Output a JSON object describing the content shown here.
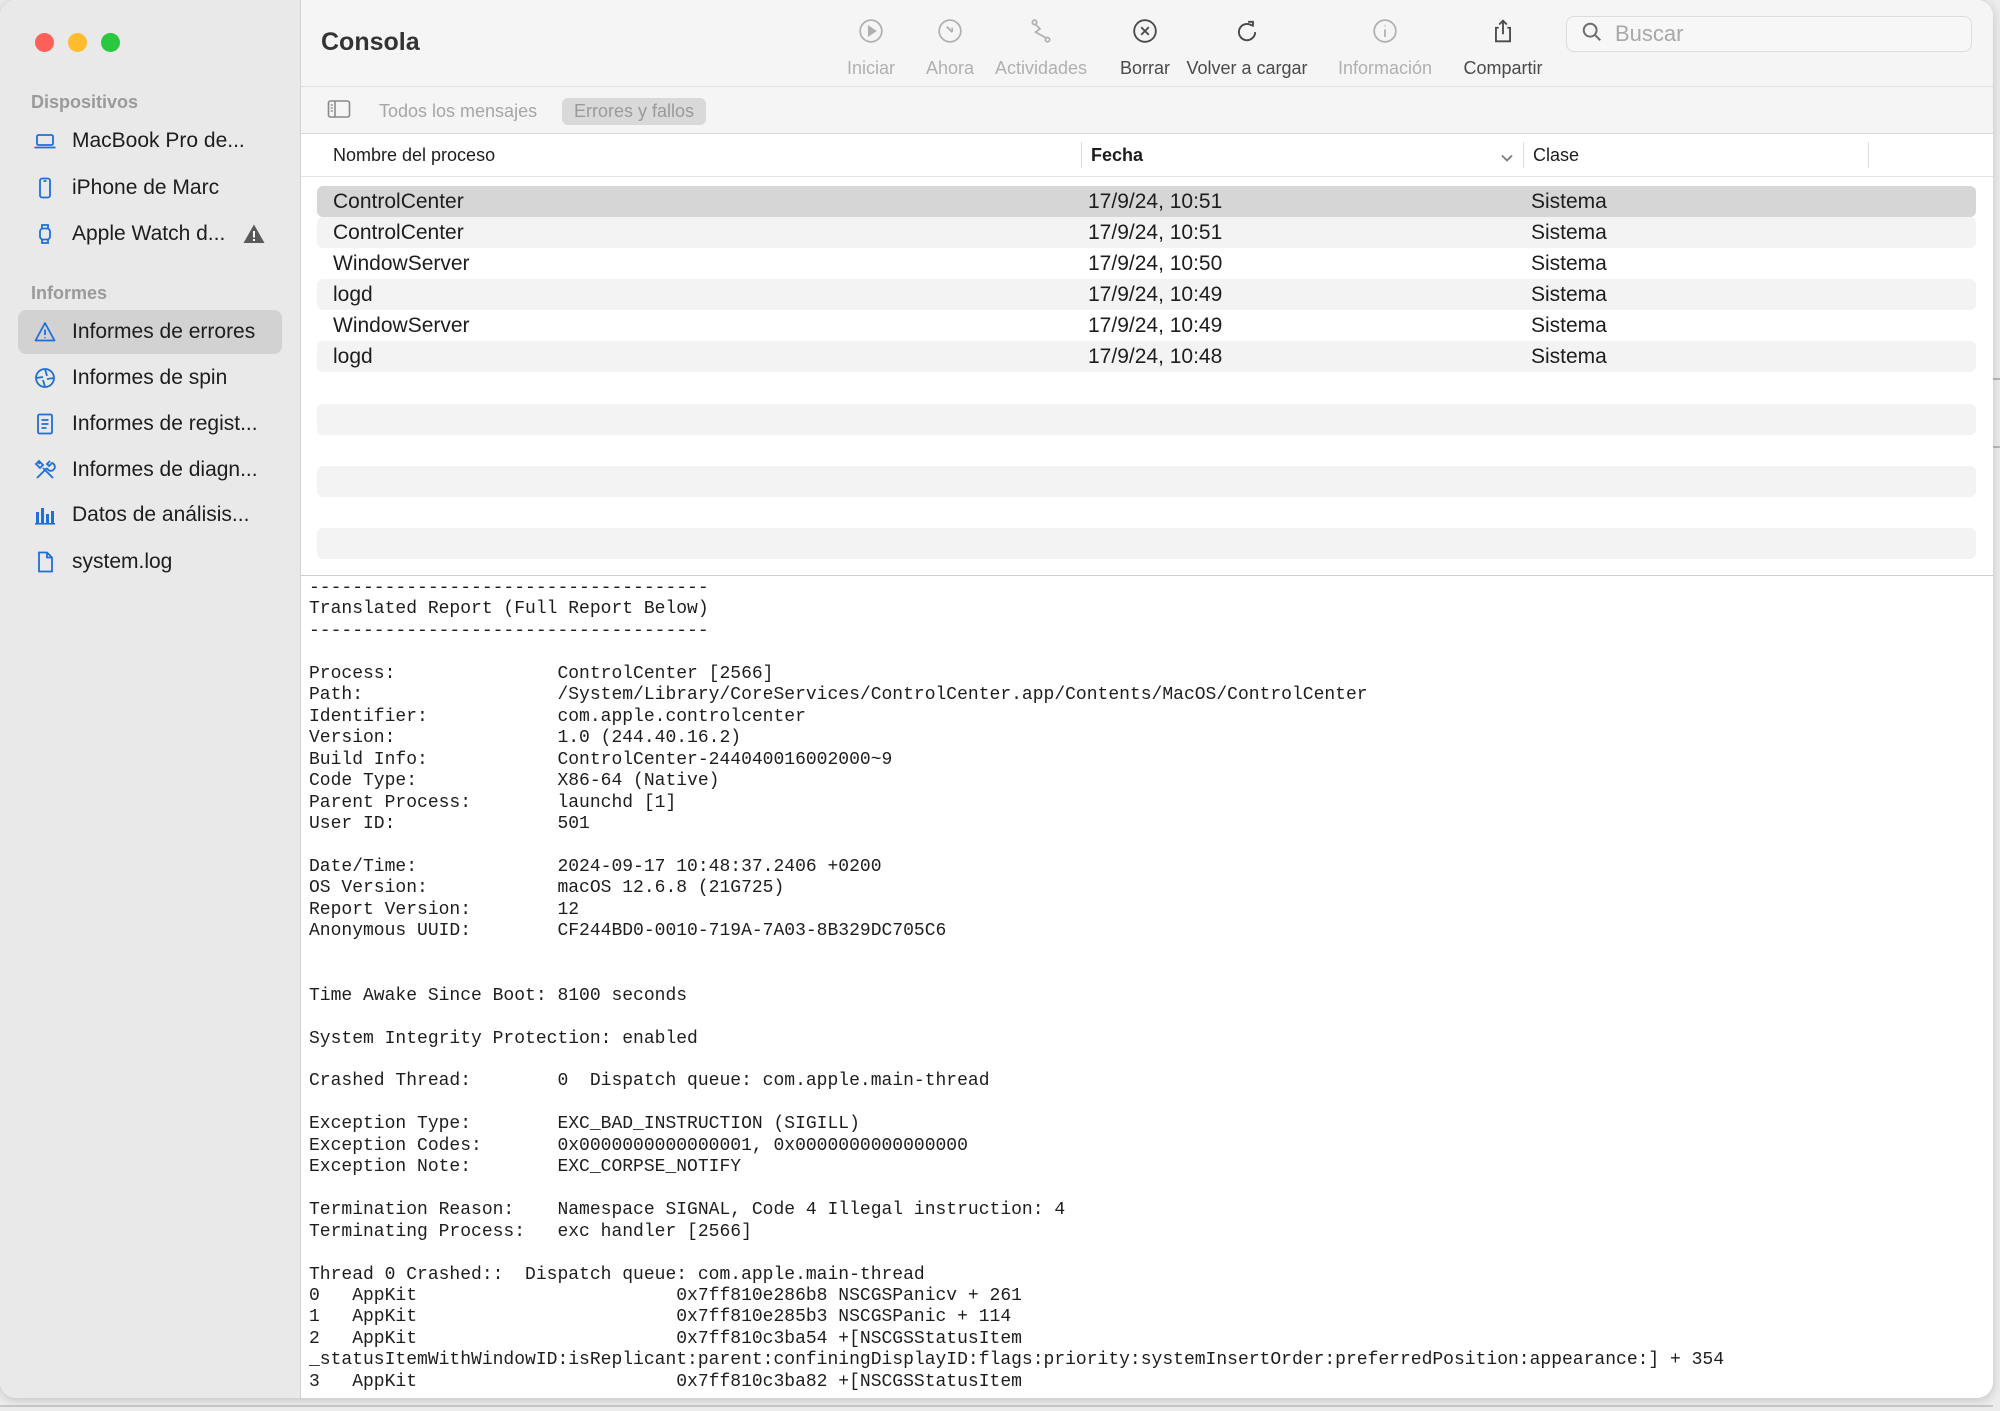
{
  "window": {
    "title": "Consola"
  },
  "sidebar": {
    "devices_header": "Dispositivos",
    "devices": [
      {
        "label": "MacBook Pro de...",
        "icon": "laptop-icon"
      },
      {
        "label": "iPhone de Marc",
        "icon": "iphone-icon"
      },
      {
        "label": "Apple Watch d...",
        "icon": "watch-icon",
        "badge_icon": "warning-triangle-icon"
      }
    ],
    "reports_header": "Informes",
    "reports": [
      {
        "label": "Informes de errores",
        "icon": "warning-triangle-icon",
        "selected": true
      },
      {
        "label": "Informes de spin",
        "icon": "aperture-icon"
      },
      {
        "label": "Informes de regist...",
        "icon": "document-lines-icon"
      },
      {
        "label": "Informes de diagn...",
        "icon": "tools-icon"
      },
      {
        "label": "Datos de análisis...",
        "icon": "bar-chart-icon"
      },
      {
        "label": "system.log",
        "icon": "document-icon"
      }
    ]
  },
  "toolbar": {
    "start_label": "Iniciar",
    "now_label": "Ahora",
    "activities_label": "Actividades",
    "clear_label": "Borrar",
    "reload_label": "Volver a cargar",
    "info_label": "Información",
    "share_label": "Compartir",
    "search_placeholder": "Buscar"
  },
  "filters": {
    "all_messages": "Todos los mensajes",
    "errors_faults": "Errores y fallos",
    "active": "Errores y fallos"
  },
  "table": {
    "columns": [
      "Nombre del proceso",
      "Fecha",
      "Clase"
    ],
    "sorted_column": "Fecha",
    "rows": [
      {
        "process": "ControlCenter",
        "date": "17/9/24, 10:51",
        "class": "Sistema",
        "selected": true
      },
      {
        "process": "ControlCenter",
        "date": "17/9/24, 10:51",
        "class": "Sistema"
      },
      {
        "process": "WindowServer",
        "date": "17/9/24, 10:50",
        "class": "Sistema"
      },
      {
        "process": "logd",
        "date": "17/9/24, 10:49",
        "class": "Sistema"
      },
      {
        "process": "WindowServer",
        "date": "17/9/24, 10:49",
        "class": "Sistema"
      },
      {
        "process": "logd",
        "date": "17/9/24, 10:48",
        "class": "Sistema"
      }
    ]
  },
  "report": {
    "text": "-------------------------------------\nTranslated Report (Full Report Below)\n-------------------------------------\n\nProcess:               ControlCenter [2566]\nPath:                  /System/Library/CoreServices/ControlCenter.app/Contents/MacOS/ControlCenter\nIdentifier:            com.apple.controlcenter\nVersion:               1.0 (244.40.16.2)\nBuild Info:            ControlCenter-244040016002000~9\nCode Type:             X86-64 (Native)\nParent Process:        launchd [1]\nUser ID:               501\n\nDate/Time:             2024-09-17 10:48:37.2406 +0200\nOS Version:            macOS 12.6.8 (21G725)\nReport Version:        12\nAnonymous UUID:        CF244BD0-0010-719A-7A03-8B329DC705C6\n\n\nTime Awake Since Boot: 8100 seconds\n\nSystem Integrity Protection: enabled\n\nCrashed Thread:        0  Dispatch queue: com.apple.main-thread\n\nException Type:        EXC_BAD_INSTRUCTION (SIGILL)\nException Codes:       0x0000000000000001, 0x0000000000000000\nException Note:        EXC_CORPSE_NOTIFY\n\nTermination Reason:    Namespace SIGNAL, Code 4 Illegal instruction: 4\nTerminating Process:   exc handler [2566]\n\nThread 0 Crashed::  Dispatch queue: com.apple.main-thread\n0   AppKit                        0x7ff810e286b8 NSCGSPanicv + 261\n1   AppKit                        0x7ff810e285b3 NSCGSPanic + 114\n2   AppKit                        0x7ff810c3ba54 +[NSCGSStatusItem\n_statusItemWithWindowID:isReplicant:parent:confiningDisplayID:flags:priority:systemInsertOrder:preferredPosition:appearance:] + 354\n3   AppKit                        0x7ff810c3ba82 +[NSCGSStatusItem"
  }
}
